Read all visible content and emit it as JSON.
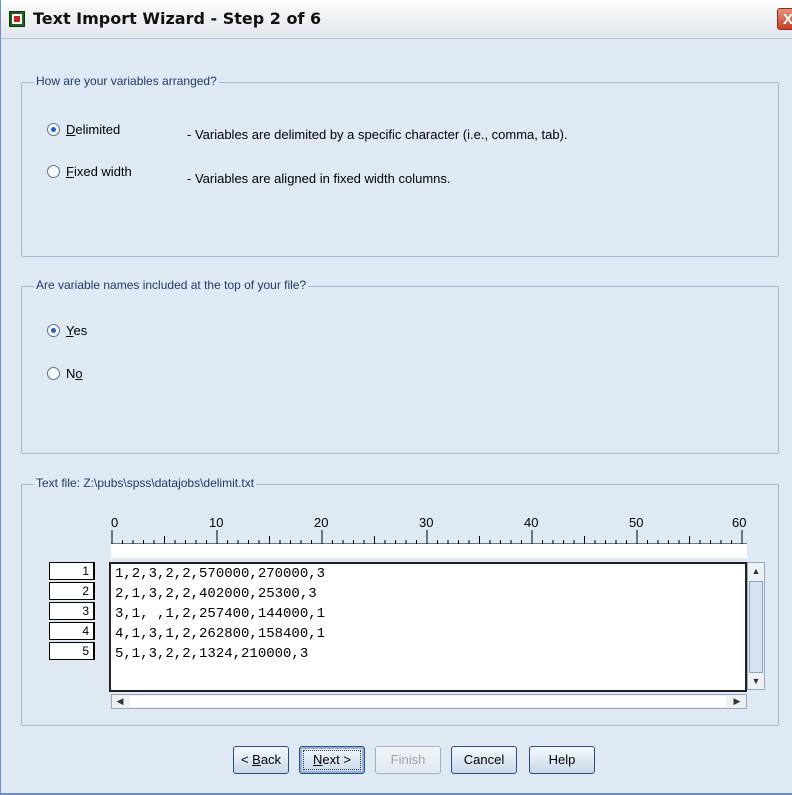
{
  "window": {
    "title": "Text Import Wizard - Step 2 of 6",
    "close_label": "X"
  },
  "arrangement": {
    "legend": "How are your variables arranged?",
    "options": [
      {
        "label_pre": "",
        "mnemonic": "D",
        "label_post": "elimited",
        "description": "- Variables are delimited by a specific character (i.e., comma, tab).",
        "checked": true
      },
      {
        "label_pre": "",
        "mnemonic": "F",
        "label_post": "ixed width",
        "description": "- Variables are aligned in fixed width columns.",
        "checked": false
      }
    ]
  },
  "names": {
    "legend": "Are variable names included at the top of your file?",
    "options": [
      {
        "label_pre": "",
        "mnemonic": "Y",
        "label_post": "es",
        "checked": true
      },
      {
        "label_pre": "N",
        "mnemonic": "o",
        "label_post": "",
        "checked": false
      }
    ]
  },
  "textfile": {
    "legend": "Text file:  Z:\\pubs\\spss\\datajobs\\delimit.txt",
    "ruler_labels": [
      "0",
      "10",
      "20",
      "30",
      "40",
      "50",
      "60"
    ],
    "row_numbers": [
      "1",
      "2",
      "3",
      "4",
      "5"
    ],
    "lines": [
      "1,2,3,2,2,570000,270000,3",
      "2,1,3,2,2,402000,25300,3",
      "3,1, ,1,2,257400,144000,1",
      "4,1,3,1,2,262800,158400,1",
      "5,1,3,2,2,1324,210000,3"
    ]
  },
  "buttons": {
    "back_pre": "< ",
    "back_mn": "B",
    "back_post": "ack",
    "next_mn": "N",
    "next_post": "ext >",
    "finish": "Finish",
    "cancel": "Cancel",
    "help": "Help"
  }
}
